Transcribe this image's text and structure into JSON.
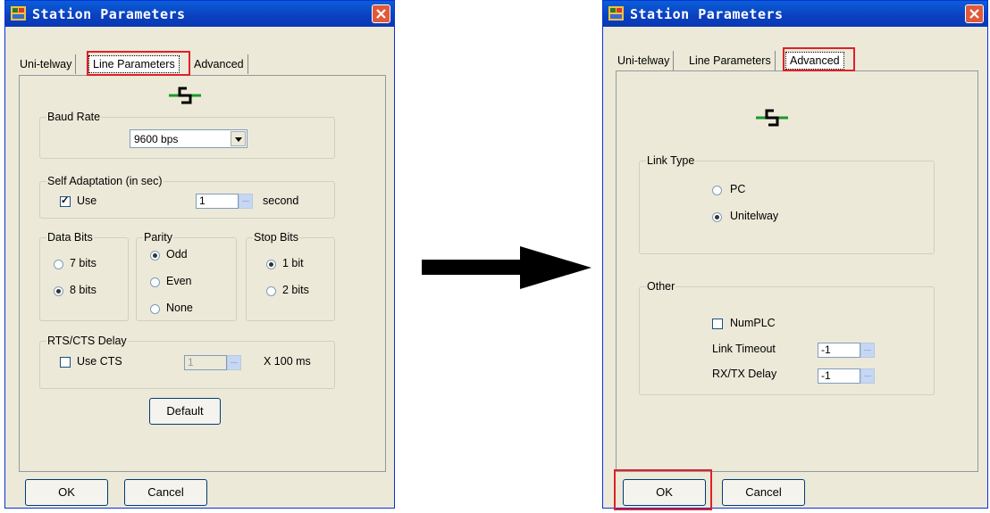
{
  "left_dialog": {
    "title": "Station Parameters",
    "tabs": [
      "Uni-telway",
      "Line Parameters",
      "Advanced"
    ],
    "active_tab": "Line Parameters",
    "baud_rate": {
      "label": "Baud Rate",
      "value": "9600  bps"
    },
    "self_adaptation": {
      "label": "Self Adaptation (in sec)",
      "use_label": "Use",
      "use_checked": true,
      "value": "1",
      "unit": "second"
    },
    "data_bits": {
      "label": "Data Bits",
      "options": [
        "7 bits",
        "8 bits"
      ],
      "selected": "8 bits"
    },
    "parity": {
      "label": "Parity",
      "options": [
        "Odd",
        "Even",
        "None"
      ],
      "selected": "Odd"
    },
    "stop_bits": {
      "label": "Stop Bits",
      "options": [
        "1 bit",
        "2 bits"
      ],
      "selected": "1 bit"
    },
    "rts_cts": {
      "label": "RTS/CTS Delay",
      "use_label": "Use CTS",
      "use_checked": false,
      "value": "1",
      "unit": "X 100 ms"
    },
    "default_button": "Default",
    "ok_button": "OK",
    "cancel_button": "Cancel"
  },
  "right_dialog": {
    "title": "Station Parameters",
    "tabs": [
      "Uni-telway",
      "Line Parameters",
      "Advanced"
    ],
    "active_tab": "Advanced",
    "link_type": {
      "label": "Link Type",
      "options": [
        "PC",
        "Unitelway"
      ],
      "selected": "Unitelway"
    },
    "other": {
      "label": "Other",
      "numplc_label": "NumPLC",
      "numplc_checked": false,
      "link_timeout_label": "Link Timeout",
      "link_timeout_value": "-1",
      "rxtx_delay_label": "RX/TX Delay",
      "rxtx_delay_value": "-1"
    },
    "ok_button": "OK",
    "cancel_button": "Cancel"
  },
  "colors": {
    "highlight": "#e0202a",
    "titlebar": "#0a5fd8",
    "dialog_bg": "#ece9d8",
    "link_icon": "#1a9a2a"
  },
  "icons": [
    "app-icon",
    "close-icon",
    "link-icon",
    "arrow-right-icon"
  ]
}
